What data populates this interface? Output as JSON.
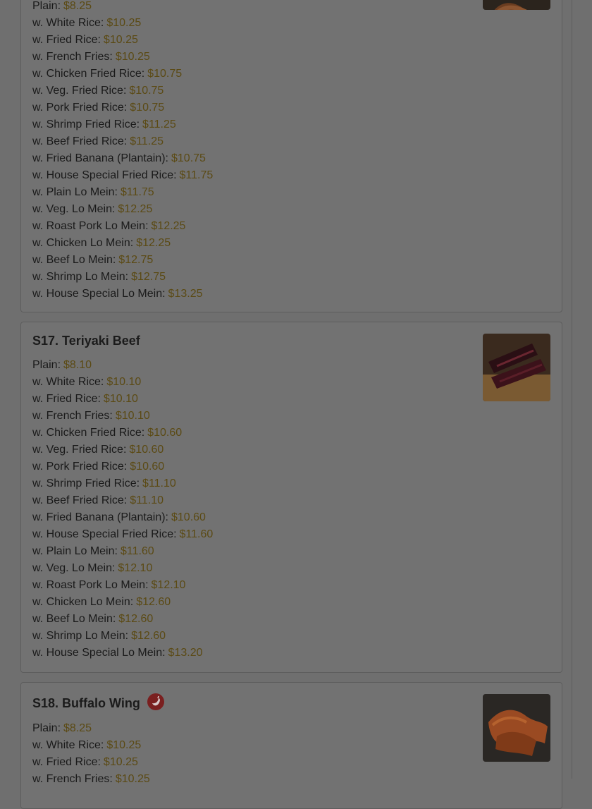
{
  "colors": {
    "overlay_bg": "#6f6f6f",
    "card_bg": "#727272",
    "price": "#5b4a14",
    "text": "#1a1a1a"
  },
  "menu": {
    "items": [
      {
        "title": "",
        "image": "wing-photo",
        "prices": [
          {
            "label": "Plain:",
            "price": "$8.25"
          },
          {
            "label": "w. White Rice:",
            "price": "$10.25"
          },
          {
            "label": "w. Fried Rice:",
            "price": "$10.25"
          },
          {
            "label": "w. French Fries:",
            "price": "$10.25"
          },
          {
            "label": "w. Chicken Fried Rice:",
            "price": "$10.75"
          },
          {
            "label": "w. Veg. Fried Rice:",
            "price": "$10.75"
          },
          {
            "label": "w. Pork Fried Rice:",
            "price": "$10.75"
          },
          {
            "label": "w. Shrimp Fried Rice:",
            "price": "$11.25"
          },
          {
            "label": "w. Beef Fried Rice:",
            "price": "$11.25"
          },
          {
            "label": "w. Fried Banana (Plantain):",
            "price": "$10.75"
          },
          {
            "label": "w. House Special Fried Rice:",
            "price": "$11.75"
          },
          {
            "label": "w. Plain Lo Mein:",
            "price": "$11.75"
          },
          {
            "label": "w. Veg. Lo Mein:",
            "price": "$12.25"
          },
          {
            "label": "w. Roast Pork Lo Mein:",
            "price": "$12.25"
          },
          {
            "label": "w. Chicken Lo Mein:",
            "price": "$12.25"
          },
          {
            "label": "w. Beef Lo Mein:",
            "price": "$12.75"
          },
          {
            "label": "w. Shrimp Lo Mein:",
            "price": "$12.75"
          },
          {
            "label": "w. House Special Lo Mein:",
            "price": "$13.25"
          }
        ]
      },
      {
        "title": "S17. Teriyaki Beef",
        "image": "teriyaki-beef-photo",
        "prices": [
          {
            "label": "Plain:",
            "price": "$8.10"
          },
          {
            "label": "w. White Rice:",
            "price": "$10.10"
          },
          {
            "label": "w. Fried Rice:",
            "price": "$10.10"
          },
          {
            "label": "w. French Fries:",
            "price": "$10.10"
          },
          {
            "label": "w. Chicken Fried Rice:",
            "price": "$10.60"
          },
          {
            "label": "w. Veg. Fried Rice:",
            "price": "$10.60"
          },
          {
            "label": "w. Pork Fried Rice:",
            "price": "$10.60"
          },
          {
            "label": "w. Shrimp Fried Rice:",
            "price": "$11.10"
          },
          {
            "label": "w. Beef Fried Rice:",
            "price": "$11.10"
          },
          {
            "label": "w. Fried Banana (Plantain):",
            "price": "$10.60"
          },
          {
            "label": "w. House Special Fried Rice:",
            "price": "$11.60"
          },
          {
            "label": "w. Plain Lo Mein:",
            "price": "$11.60"
          },
          {
            "label": "w. Veg. Lo Mein:",
            "price": "$12.10"
          },
          {
            "label": "w. Roast Pork Lo Mein:",
            "price": "$12.10"
          },
          {
            "label": "w. Chicken Lo Mein:",
            "price": "$12.60"
          },
          {
            "label": "w. Beef Lo Mein:",
            "price": "$12.60"
          },
          {
            "label": "w. Shrimp Lo Mein:",
            "price": "$12.60"
          },
          {
            "label": "w. House Special Lo Mein:",
            "price": "$13.20"
          }
        ]
      },
      {
        "title": "S18. Buffalo Wing",
        "spicy_icon": "hot-pepper-icon",
        "image": "buffalo-wing-photo",
        "prices": [
          {
            "label": "Plain:",
            "price": "$8.25"
          },
          {
            "label": "w. White Rice:",
            "price": "$10.25"
          },
          {
            "label": "w. Fried Rice:",
            "price": "$10.25"
          },
          {
            "label": "w. French Fries:",
            "price": "$10.25"
          }
        ]
      }
    ]
  }
}
